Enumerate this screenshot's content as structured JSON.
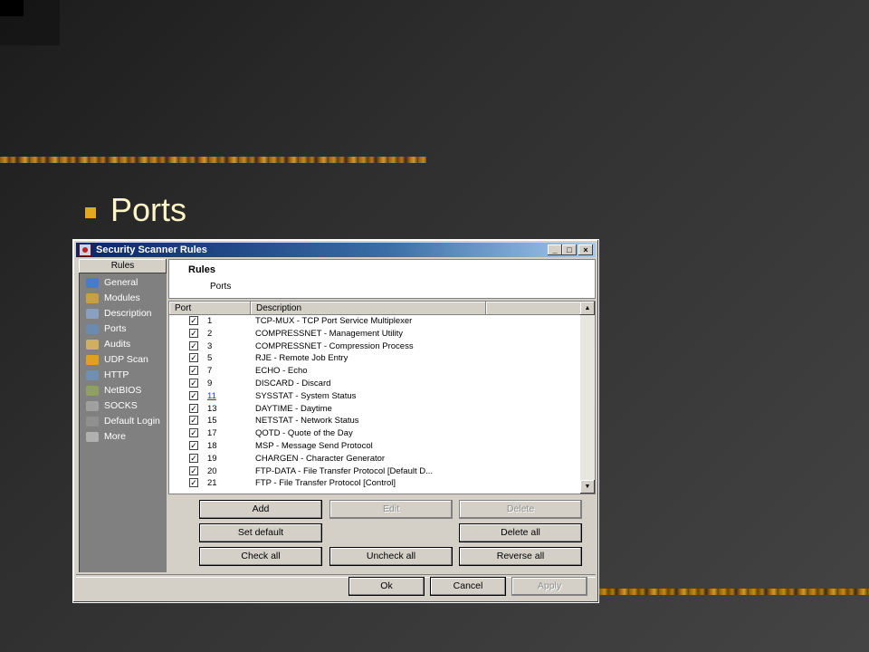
{
  "slide": {
    "bullet": "Ports",
    "accent": "#e3a81f"
  },
  "window": {
    "title": "Security Scanner Rules",
    "controls": {
      "minimize": "_",
      "maximize": "□",
      "close": "×"
    }
  },
  "sidebar": {
    "header": "Rules",
    "items": [
      {
        "label": "General",
        "icon": "general-icon",
        "color": "#4a7ad0"
      },
      {
        "label": "Modules",
        "icon": "modules-icon",
        "color": "#c8a040"
      },
      {
        "label": "Description",
        "icon": "description-icon",
        "color": "#8aa0c0"
      },
      {
        "label": "Ports",
        "icon": "ports-icon",
        "color": "#6a8ab0"
      },
      {
        "label": "Audits",
        "icon": "audits-icon",
        "color": "#d0b060"
      },
      {
        "label": "UDP Scan",
        "icon": "udp-scan-icon",
        "color": "#e0a020"
      },
      {
        "label": "HTTP",
        "icon": "http-icon",
        "color": "#7090b0"
      },
      {
        "label": "NetBIOS",
        "icon": "netbios-icon",
        "color": "#90a060"
      },
      {
        "label": "SOCKS",
        "icon": "socks-icon",
        "color": "#a0a0a0"
      },
      {
        "label": "Default Login",
        "icon": "default-login-icon",
        "color": "#909090"
      },
      {
        "label": "More",
        "icon": "more-icon",
        "color": "#b0b0b0"
      }
    ]
  },
  "content": {
    "title": "Rules",
    "subtitle": "Ports"
  },
  "list": {
    "columns": [
      "Port",
      "Description",
      ""
    ],
    "rows": [
      {
        "port": "1",
        "desc": "TCP-MUX - TCP Port Service Multiplexer",
        "checked": "✓"
      },
      {
        "port": "2",
        "desc": "COMPRESSNET - Management Utility",
        "checked": "✓"
      },
      {
        "port": "3",
        "desc": "COMPRESSNET - Compression Process",
        "checked": "✓"
      },
      {
        "port": "5",
        "desc": "RJE - Remote Job Entry",
        "checked": "✓"
      },
      {
        "port": "7",
        "desc": "ECHO - Echo",
        "checked": "✓"
      },
      {
        "port": "9",
        "desc": "DISCARD - Discard",
        "checked": "✓"
      },
      {
        "port": "11",
        "desc": "SYSSTAT - System Status",
        "checked": "✓"
      },
      {
        "port": "13",
        "desc": "DAYTIME - Daytime",
        "checked": "✓"
      },
      {
        "port": "15",
        "desc": "NETSTAT - Network Status",
        "checked": "✓"
      },
      {
        "port": "17",
        "desc": "QOTD - Quote of the Day",
        "checked": "✓"
      },
      {
        "port": "18",
        "desc": "MSP - Message Send Protocol",
        "checked": "✓"
      },
      {
        "port": "19",
        "desc": "CHARGEN - Character Generator",
        "checked": "✓"
      },
      {
        "port": "20",
        "desc": "FTP-DATA - File Transfer Protocol [Default D...",
        "checked": "✓"
      },
      {
        "port": "21",
        "desc": "FTP - File Transfer Protocol [Control]",
        "checked": "✓"
      }
    ],
    "scroll_up": "▲",
    "scroll_down": "▼"
  },
  "buttons": {
    "add": "Add",
    "edit": "Edit",
    "delete": "Delete",
    "set_default": "Set default",
    "delete_all": "Delete all",
    "check_all": "Check all",
    "uncheck_all": "Uncheck all",
    "reverse_all": "Reverse all",
    "ok": "Ok",
    "cancel": "Cancel",
    "apply": "Apply"
  }
}
